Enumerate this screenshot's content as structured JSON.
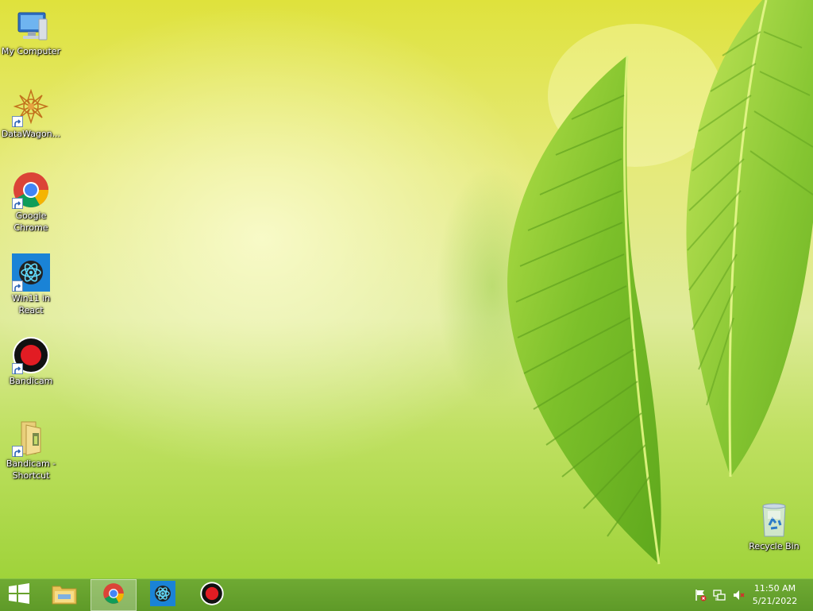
{
  "desktop": {
    "icons": [
      {
        "label": "My Computer",
        "icon": "computer-icon",
        "shortcut": false
      },
      {
        "label": "DataWagon...",
        "icon": "datawagon-icon",
        "shortcut": true
      },
      {
        "label": "Google Chrome",
        "icon": "chrome-icon",
        "shortcut": true
      },
      {
        "label": "Win11 in React",
        "icon": "react-icon",
        "shortcut": true
      },
      {
        "label": "Bandicam",
        "icon": "bandicam-icon",
        "shortcut": true
      },
      {
        "label": "Bandicam - Shortcut",
        "icon": "folder-icon",
        "shortcut": true
      }
    ],
    "recycle_bin": {
      "label": "Recycle Bin",
      "icon": "recycle-bin-icon"
    }
  },
  "taskbar": {
    "start_icon": "windows-logo-icon",
    "pinned": [
      {
        "icon": "file-explorer-icon",
        "active": false
      },
      {
        "icon": "chrome-icon",
        "active": true
      },
      {
        "icon": "react-icon",
        "active": false
      },
      {
        "icon": "bandicam-icon",
        "active": false
      }
    ],
    "tray": [
      "action-center-flag-icon",
      "network-icon",
      "volume-muted-icon"
    ],
    "clock": {
      "time": "11:50 AM",
      "date": "5/21/2022"
    }
  },
  "colors": {
    "taskbar": "#63a02c",
    "wallpaper_top": "#dfe23c",
    "wallpaper_bottom": "#9fd33a",
    "leaf": "#7fc22e"
  }
}
